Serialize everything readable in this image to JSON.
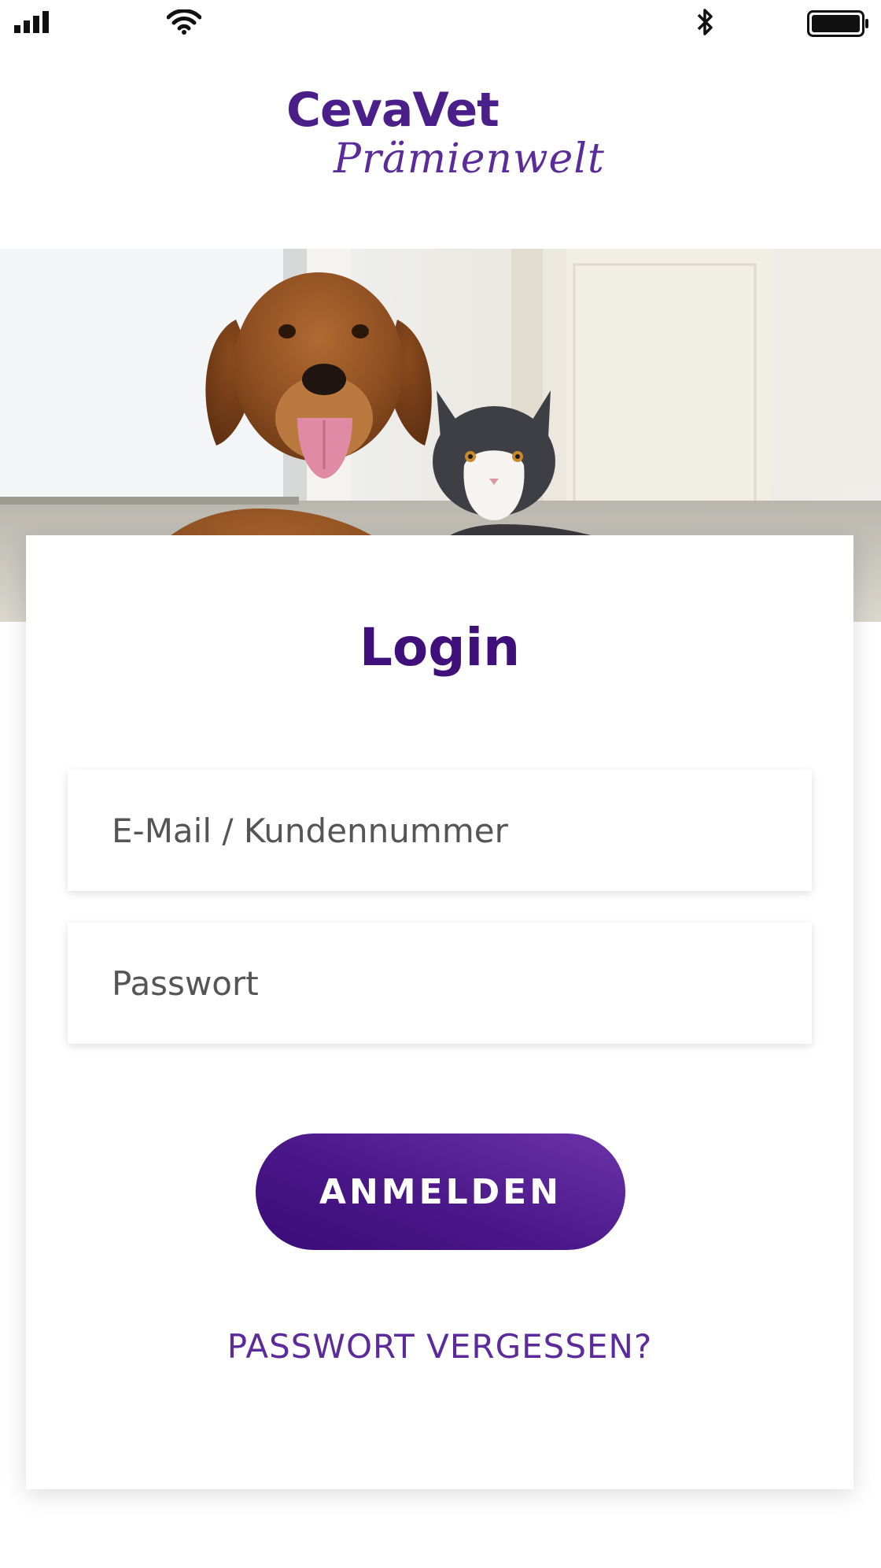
{
  "status_bar": {
    "signal_icon": "cellular-signal-icon",
    "wifi_icon": "wifi-icon",
    "bluetooth_icon": "bluetooth-icon",
    "battery_icon": "battery-icon"
  },
  "logo": {
    "brand": "CevaVet",
    "subtitle": "Prämienwelt"
  },
  "hero": {
    "image": "dog-and-cat-photo"
  },
  "login": {
    "title": "Login",
    "email_placeholder": "E-Mail / Kundennummer",
    "password_placeholder": "Passwort",
    "submit_label": "ANMELDEN",
    "forgot_label": "PASSWORT VERGESSEN?"
  },
  "colors": {
    "brand_purple": "#4a1f8a",
    "title_purple": "#3f0f7a",
    "button_gradient_start": "#6a34a8",
    "button_gradient_end": "#3a0c78",
    "link_purple": "#5b2a9b"
  }
}
